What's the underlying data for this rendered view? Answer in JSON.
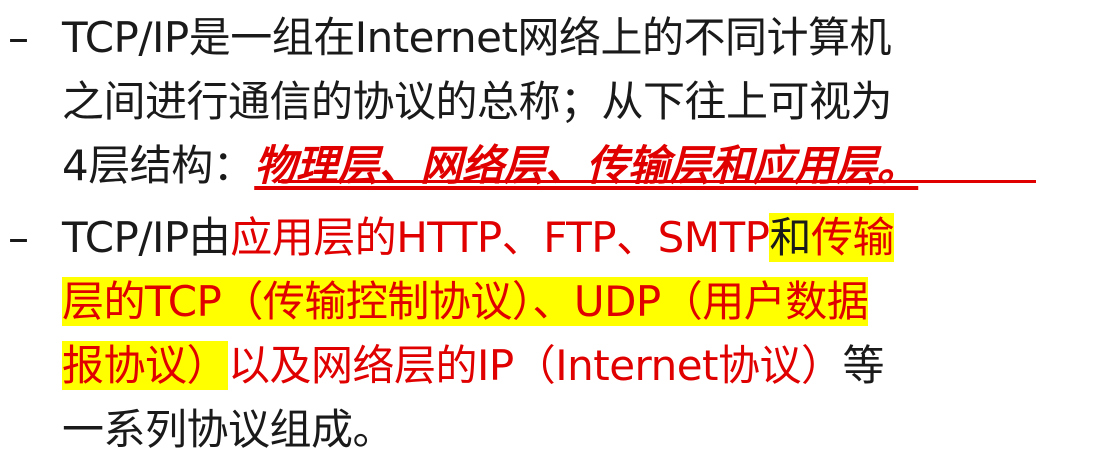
{
  "bullets": {
    "dash": "–",
    "b1": {
      "l1": "TCP/IP是一组在Internet网络上的不同计算机",
      "l2": "之间进行通信的协议的总称；从下往上可视为",
      "l3_prefix": "4层结构：",
      "l3_emph": "物理层、网络层、传输层和应用层。"
    },
    "b2": {
      "l1_a": "TCP/IP由",
      "l1_b": "应用层的HTTP、FTP、SMTP",
      "l1_c": "和",
      "l1_d": "传输",
      "l2": "层的TCP（传输控制协议）、UDP（用户数据",
      "l3_a": "报协议）",
      "l3_b": "以及网络层的IP（Internet协议）",
      "l3_c": "等",
      "l4": "一系列协议组成。"
    }
  },
  "colors": {
    "emphasis_red": "#e00000",
    "highlight_yellow": "#ffff00",
    "text": "#1a1a1a"
  }
}
